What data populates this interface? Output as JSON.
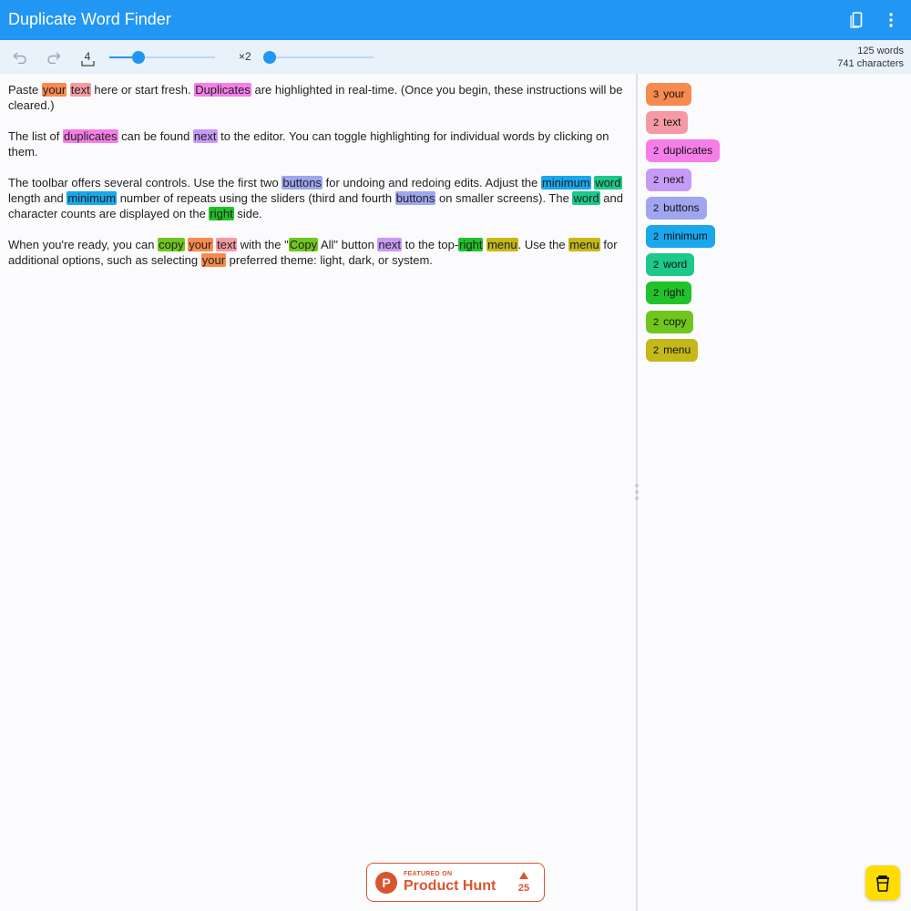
{
  "app": {
    "title": "Duplicate Word Finder"
  },
  "header": {
    "copy_icon": "copy-all-icon",
    "menu_icon": "more-vert-icon"
  },
  "toolbar": {
    "undo_icon": "undo-icon",
    "redo_icon": "redo-icon",
    "min_length_value": "4",
    "min_length_fraction": 0.28,
    "min_repeats_value": "×2",
    "min_repeats_fraction": 0.0
  },
  "stats": {
    "words": "125 words",
    "characters": "741 characters"
  },
  "colors": {
    "your": "#f78a4e",
    "text": "#f59aa4",
    "duplicates": "#f57ee9",
    "next": "#c79af6",
    "buttons": "#9fa6ef",
    "minimum": "#1aa7ec",
    "word": "#1bc98a",
    "right": "#20c32a",
    "copy": "#6fc71d",
    "menu": "#c4b81a"
  },
  "editor": {
    "paragraphs": [
      [
        {
          "t": "Paste "
        },
        {
          "t": "your",
          "w": "your"
        },
        {
          "t": " "
        },
        {
          "t": "text",
          "w": "text"
        },
        {
          "t": " here or start fresh. "
        },
        {
          "t": "Duplicates",
          "w": "duplicates"
        },
        {
          "t": " are highlighted in real-time. (Once you begin, these instructions will be cleared.)"
        }
      ],
      [
        {
          "t": "The list of "
        },
        {
          "t": "duplicates",
          "w": "duplicates"
        },
        {
          "t": " can be found "
        },
        {
          "t": "next",
          "w": "next"
        },
        {
          "t": " to the editor. You can toggle highlighting for individual words by clicking on them."
        }
      ],
      [
        {
          "t": "The toolbar offers several controls. Use the first two "
        },
        {
          "t": "buttons",
          "w": "buttons"
        },
        {
          "t": " for undoing and redoing edits. Adjust the "
        },
        {
          "t": "minimum",
          "w": "minimum"
        },
        {
          "t": " "
        },
        {
          "t": "word",
          "w": "word"
        },
        {
          "t": " length and "
        },
        {
          "t": "minimum",
          "w": "minimum"
        },
        {
          "t": " number of repeats using the sliders (third and fourth "
        },
        {
          "t": "buttons",
          "w": "buttons"
        },
        {
          "t": " on smaller screens). The "
        },
        {
          "t": "word",
          "w": "word"
        },
        {
          "t": " and character counts are displayed on the "
        },
        {
          "t": "right",
          "w": "right"
        },
        {
          "t": " side."
        }
      ],
      [
        {
          "t": "When you're ready, you can "
        },
        {
          "t": "copy",
          "w": "copy"
        },
        {
          "t": " "
        },
        {
          "t": "your",
          "w": "your"
        },
        {
          "t": " "
        },
        {
          "t": "text",
          "w": "text"
        },
        {
          "t": " with the \""
        },
        {
          "t": "Copy",
          "w": "copy"
        },
        {
          "t": " All\" button "
        },
        {
          "t": "next",
          "w": "next"
        },
        {
          "t": " to the top-"
        },
        {
          "t": "right",
          "w": "right"
        },
        {
          "t": " "
        },
        {
          "t": "menu",
          "w": "menu"
        },
        {
          "t": ". Use the "
        },
        {
          "t": "menu",
          "w": "menu"
        },
        {
          "t": " for additional options, such as selecting "
        },
        {
          "t": "your",
          "w": "your"
        },
        {
          "t": " preferred theme: light, dark, or system."
        }
      ]
    ]
  },
  "sidebar": {
    "items": [
      {
        "count": "3",
        "word": "your"
      },
      {
        "count": "2",
        "word": "text"
      },
      {
        "count": "2",
        "word": "duplicates"
      },
      {
        "count": "2",
        "word": "next"
      },
      {
        "count": "2",
        "word": "buttons"
      },
      {
        "count": "2",
        "word": "minimum"
      },
      {
        "count": "2",
        "word": "word"
      },
      {
        "count": "2",
        "word": "right"
      },
      {
        "count": "2",
        "word": "copy"
      },
      {
        "count": "2",
        "word": "menu"
      }
    ]
  },
  "product_hunt": {
    "featured": "FEATURED ON",
    "name": "Product Hunt",
    "logo_letter": "P",
    "votes": "25"
  },
  "coffee": {
    "icon": "coffee-cup-icon"
  }
}
